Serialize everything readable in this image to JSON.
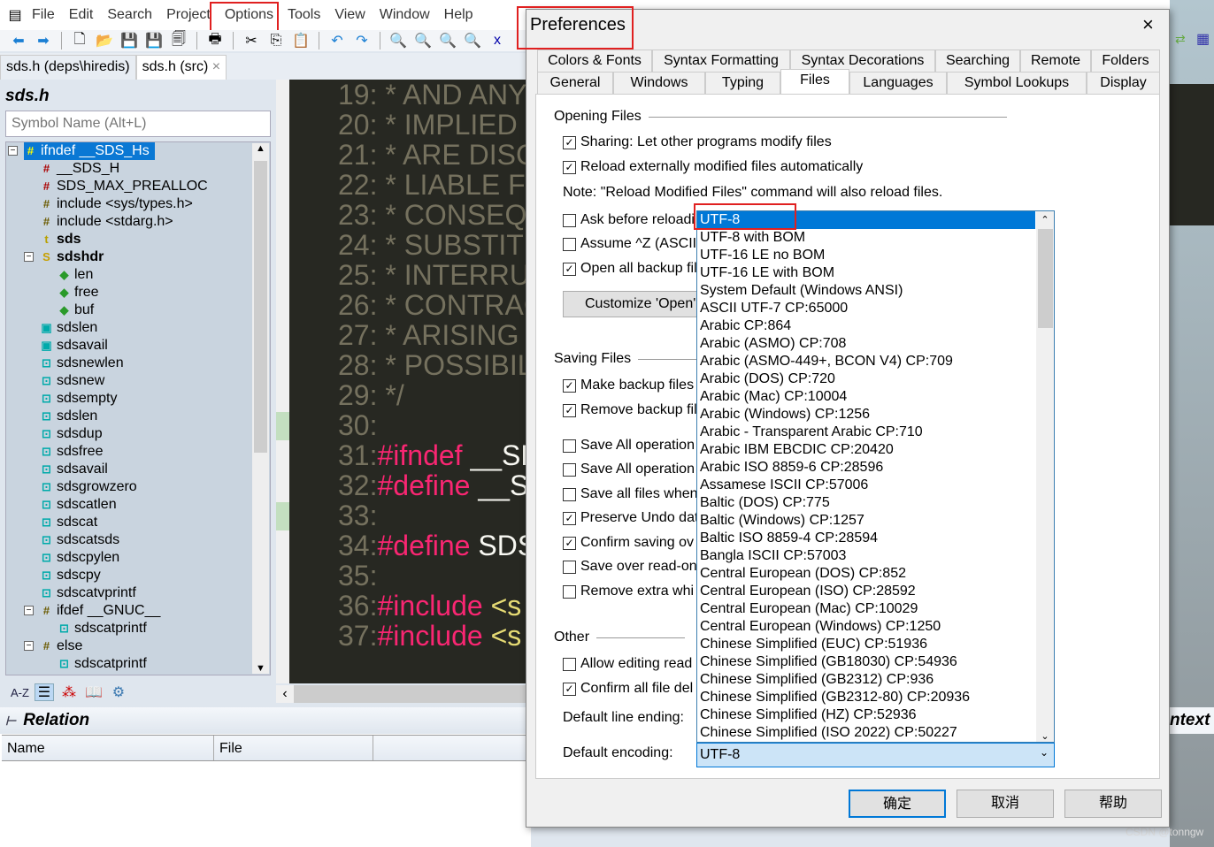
{
  "menubar": {
    "items": [
      "File",
      "Edit",
      "Search",
      "Project",
      "Options",
      "Tools",
      "View",
      "Window",
      "Help"
    ],
    "highlighted": "Options"
  },
  "filetabs": [
    {
      "label": "sds.h (deps\\hiredis)"
    },
    {
      "label": "sds.h (src)",
      "close": "×"
    }
  ],
  "symbol_panel": {
    "title": "sds.h",
    "search_placeholder": "Symbol Name (Alt+L)",
    "tree": [
      {
        "label": "ifndef __SDS_Hs",
        "level": 0,
        "icon": "conditional-icon",
        "expander": "−",
        "selected": true
      },
      {
        "label": "__SDS_H",
        "level": 1,
        "icon": "define-icon"
      },
      {
        "label": "SDS_MAX_PREALLOC",
        "level": 1,
        "icon": "define-icon"
      },
      {
        "label": "include <sys/types.h>",
        "level": 1,
        "icon": "include-icon"
      },
      {
        "label": "include <stdarg.h>",
        "level": 1,
        "icon": "include-icon"
      },
      {
        "label": "sds",
        "level": 1,
        "icon": "typedef-icon",
        "bold": true
      },
      {
        "label": "sdshdr",
        "level": 1,
        "icon": "struct-icon",
        "expander": "−",
        "bold": true
      },
      {
        "label": "len",
        "level": 2,
        "icon": "member-icon"
      },
      {
        "label": "free",
        "level": 2,
        "icon": "member-icon"
      },
      {
        "label": "buf",
        "level": 2,
        "icon": "member-icon"
      },
      {
        "label": "sdslen",
        "level": 1,
        "icon": "inline-function-icon"
      },
      {
        "label": "sdsavail",
        "level": 1,
        "icon": "inline-function-icon"
      },
      {
        "label": "sdsnewlen",
        "level": 1,
        "icon": "function-icon"
      },
      {
        "label": "sdsnew",
        "level": 1,
        "icon": "function-icon"
      },
      {
        "label": "sdsempty",
        "level": 1,
        "icon": "function-icon"
      },
      {
        "label": "sdslen",
        "level": 1,
        "icon": "function-icon"
      },
      {
        "label": "sdsdup",
        "level": 1,
        "icon": "function-icon"
      },
      {
        "label": "sdsfree",
        "level": 1,
        "icon": "function-icon"
      },
      {
        "label": "sdsavail",
        "level": 1,
        "icon": "function-icon"
      },
      {
        "label": "sdsgrowzero",
        "level": 1,
        "icon": "function-icon"
      },
      {
        "label": "sdscatlen",
        "level": 1,
        "icon": "function-icon"
      },
      {
        "label": "sdscat",
        "level": 1,
        "icon": "function-icon"
      },
      {
        "label": "sdscatsds",
        "level": 1,
        "icon": "function-icon"
      },
      {
        "label": "sdscpylen",
        "level": 1,
        "icon": "function-icon"
      },
      {
        "label": "sdscpy",
        "level": 1,
        "icon": "function-icon"
      },
      {
        "label": "sdscatvprintf",
        "level": 1,
        "icon": "function-icon"
      },
      {
        "label": "ifdef __GNUC__",
        "level": 1,
        "icon": "conditional-icon",
        "expander": "−"
      },
      {
        "label": "sdscatprintf",
        "level": 2,
        "icon": "function-icon"
      },
      {
        "label": "else",
        "level": 1,
        "icon": "conditional-icon",
        "expander": "−"
      },
      {
        "label": "sdscatprintf",
        "level": 2,
        "icon": "function-icon"
      }
    ],
    "bottom_tools": [
      {
        "icon": "sort-az-icon",
        "label": "A-Z"
      },
      {
        "icon": "list-view-icon"
      },
      {
        "icon": "category-icon"
      },
      {
        "icon": "book-icon"
      },
      {
        "icon": "gear-icon"
      }
    ]
  },
  "code": [
    {
      "n": "19:",
      "parts": [
        [
          "c",
          " * AND ANY"
        ]
      ]
    },
    {
      "n": "20:",
      "parts": [
        [
          "c",
          " * IMPLIED"
        ]
      ]
    },
    {
      "n": "21:",
      "parts": [
        [
          "c",
          " * ARE DISC"
        ]
      ]
    },
    {
      "n": "22:",
      "parts": [
        [
          "c",
          " * LIABLE FO"
        ]
      ]
    },
    {
      "n": "23:",
      "parts": [
        [
          "c",
          " * CONSEQ"
        ]
      ]
    },
    {
      "n": "24:",
      "parts": [
        [
          "c",
          " * SUBSTITU"
        ]
      ]
    },
    {
      "n": "25:",
      "parts": [
        [
          "c",
          " * INTERRU"
        ]
      ]
    },
    {
      "n": "26:",
      "parts": [
        [
          "c",
          " * CONTRAC"
        ]
      ]
    },
    {
      "n": "27:",
      "parts": [
        [
          "c",
          " * ARISING"
        ]
      ]
    },
    {
      "n": "28:",
      "parts": [
        [
          "c",
          " * POSSIBIL"
        ]
      ]
    },
    {
      "n": "29:",
      "parts": [
        [
          "c",
          " */"
        ]
      ]
    },
    {
      "n": "30:",
      "parts": []
    },
    {
      "n": "31:",
      "parts": [
        [
          "k",
          "#ifndef"
        ],
        [
          "w",
          " __SD"
        ]
      ]
    },
    {
      "n": "32:",
      "parts": [
        [
          "k",
          "#define"
        ],
        [
          "w",
          " __S"
        ]
      ]
    },
    {
      "n": "33:",
      "parts": []
    },
    {
      "n": "34:",
      "parts": [
        [
          "k",
          "#define"
        ],
        [
          "w",
          " SDS"
        ]
      ]
    },
    {
      "n": "35:",
      "parts": []
    },
    {
      "n": "36:",
      "parts": [
        [
          "k",
          "#include"
        ],
        [
          "y",
          " <s"
        ]
      ]
    },
    {
      "n": "37:",
      "parts": [
        [
          "k",
          "#include"
        ],
        [
          "y",
          " <s"
        ]
      ]
    }
  ],
  "relation": {
    "title": "Relation",
    "columns": [
      "Name",
      "File",
      ""
    ]
  },
  "right_panel": {
    "context_title": "ntext"
  },
  "watermark": "CSDN @tonngw",
  "dialog": {
    "title": "Preferences",
    "close": "×",
    "tabs_row1": [
      "Colors & Fonts",
      "Syntax Formatting",
      "Syntax Decorations",
      "Searching",
      "Remote",
      "Folders"
    ],
    "tabs_row2": [
      "General",
      "Windows",
      "Typing",
      "Files",
      "Languages",
      "Symbol Lookups",
      "Display"
    ],
    "active_tab": "Files",
    "opening": {
      "heading": "Opening Files",
      "sharing": {
        "label": "Sharing: Let other programs modify files",
        "checked": true
      },
      "reload": {
        "label": "Reload externally modified files automatically",
        "checked": true
      },
      "note": "Note: \"Reload Modified Files\" command will also reload files.",
      "ask": {
        "label": "Ask before reloadi",
        "checked": false
      },
      "assume": {
        "label": "Assume ^Z (ASCII",
        "checked": false
      },
      "open_backup": {
        "label": "Open all backup fil",
        "checked": true
      },
      "customize": "Customize 'Open' "
    },
    "saving": {
      "heading": "Saving Files",
      "items": [
        {
          "label": "Make backup files",
          "checked": true
        },
        {
          "label": "Remove backup fil",
          "checked": true
        },
        {
          "label": "Save All operation",
          "checked": false
        },
        {
          "label": "Save All operation",
          "checked": false
        },
        {
          "label": "Save all files when",
          "checked": false
        },
        {
          "label": "Preserve Undo dat",
          "checked": true
        },
        {
          "label": "Confirm saving ov",
          "checked": true
        },
        {
          "label": "Save over read-on",
          "checked": false
        },
        {
          "label": "Remove extra whi",
          "checked": false
        }
      ]
    },
    "other": {
      "heading": "Other",
      "items": [
        {
          "label": "Allow editing read",
          "checked": false
        },
        {
          "label": "Confirm all file del",
          "checked": true
        }
      ],
      "line_ending_label": "Default line ending:",
      "encoding_label": "Default encoding:",
      "encoding_value": "UTF-8"
    },
    "encoding_options": [
      "UTF-8",
      "UTF-8 with BOM",
      "UTF-16 LE no BOM",
      "UTF-16 LE with BOM",
      "System Default (Windows ANSI)",
      "ASCII UTF-7  CP:65000",
      "Arabic  CP:864",
      "Arabic (ASMO)  CP:708",
      "Arabic (ASMO-449+, BCON V4)  CP:709",
      "Arabic (DOS)  CP:720",
      "Arabic (Mac)  CP:10004",
      "Arabic (Windows)  CP:1256",
      "Arabic - Transparent Arabic  CP:710",
      "Arabic IBM EBCDIC  CP:20420",
      "Arabic ISO 8859-6   CP:28596",
      "Assamese ISCII  CP:57006",
      "Baltic (DOS)  CP:775",
      "Baltic (Windows)  CP:1257",
      "Baltic ISO 8859-4   CP:28594",
      "Bangla ISCII  CP:57003",
      "Central European (DOS)  CP:852",
      "Central European (ISO)  CP:28592",
      "Central European (Mac)  CP:10029",
      "Central European (Windows)  CP:1250",
      "Chinese Simplified (EUC)  CP:51936",
      "Chinese Simplified (GB18030)  CP:54936",
      "Chinese Simplified (GB2312)  CP:936",
      "Chinese Simplified (GB2312-80)  CP:20936",
      "Chinese Simplified (HZ)  CP:52936",
      "Chinese Simplified (ISO 2022)  CP:50227"
    ],
    "selected_option": "UTF-8",
    "buttons": {
      "ok": "确定",
      "cancel": "取消",
      "help": "帮助"
    }
  },
  "colors": {
    "accent": "#0078d7",
    "highlight_box": "#e02020",
    "code_bg": "#272822",
    "keyword": "#f92672",
    "comment": "#75715e"
  }
}
